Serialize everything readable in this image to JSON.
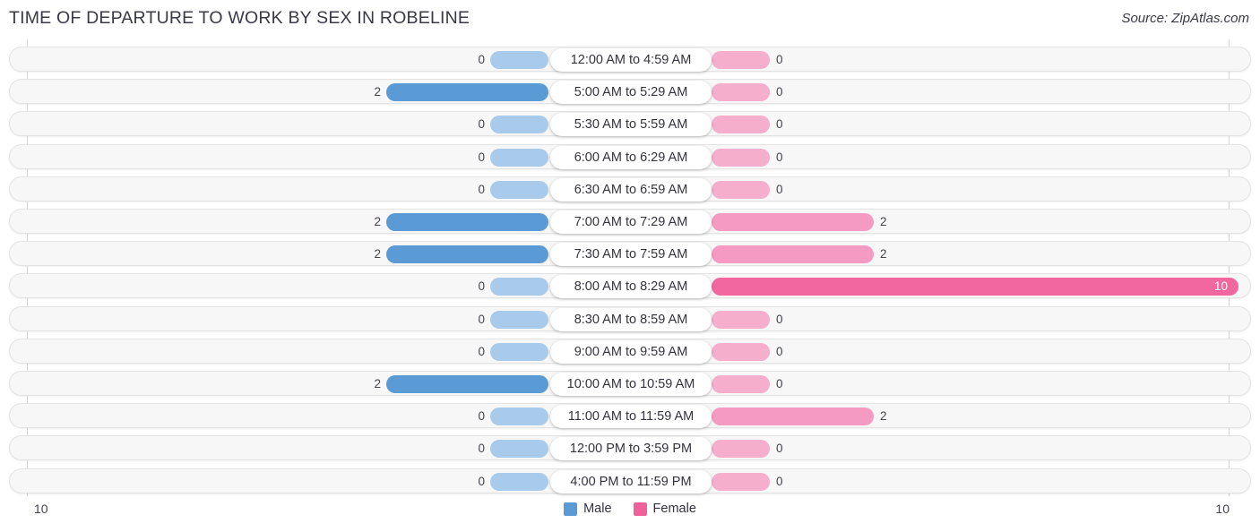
{
  "header": {
    "title": "TIME OF DEPARTURE TO WORK BY SEX IN ROBELINE",
    "source": "Source: ZipAtlas.com"
  },
  "axis": {
    "left_end_label": "10",
    "right_end_label": "10"
  },
  "legend": {
    "items": [
      {
        "label": "Male",
        "color": "#5b9bd5",
        "icon": "square-swatch-icon"
      },
      {
        "label": "Female",
        "color": "#f0619b",
        "icon": "square-swatch-icon"
      }
    ]
  },
  "colors": {
    "male_zero": "#a8cbec",
    "male_value": "#5b9bd5",
    "female_zero": "#f5aecb",
    "female_small": "#f59ac0",
    "female_large": "#f2689e",
    "track": "#f7f7f7",
    "track_border": "#e3e3e3",
    "gridline": "#d6d6d6",
    "text": "#33333d"
  },
  "chart_data": {
    "type": "bar",
    "title": "TIME OF DEPARTURE TO WORK BY SEX IN ROBELINE",
    "subtitle": "",
    "xlabel": "",
    "ylabel": "",
    "orientation": "horizontal-diverging",
    "grid": false,
    "legend_position": "bottom-center",
    "xlim": [
      10,
      10
    ],
    "axis_left_max": 10,
    "axis_right_max": 10,
    "categories": [
      "12:00 AM to 4:59 AM",
      "5:00 AM to 5:29 AM",
      "5:30 AM to 5:59 AM",
      "6:00 AM to 6:29 AM",
      "6:30 AM to 6:59 AM",
      "7:00 AM to 7:29 AM",
      "7:30 AM to 7:59 AM",
      "8:00 AM to 8:29 AM",
      "8:30 AM to 8:59 AM",
      "9:00 AM to 9:59 AM",
      "10:00 AM to 10:59 AM",
      "11:00 AM to 11:59 AM",
      "12:00 PM to 3:59 PM",
      "4:00 PM to 11:59 PM"
    ],
    "series": [
      {
        "name": "Male",
        "side": "left",
        "color": "#5b9bd5",
        "values": [
          0,
          2,
          0,
          0,
          0,
          2,
          2,
          0,
          0,
          0,
          2,
          0,
          0,
          0
        ]
      },
      {
        "name": "Female",
        "side": "right",
        "color": "#f0619b",
        "values": [
          0,
          0,
          0,
          0,
          0,
          2,
          2,
          10,
          0,
          0,
          0,
          2,
          0,
          0
        ]
      }
    ]
  },
  "rows": [
    {
      "label": "12:00 AM to 4:59 AM",
      "male": "0",
      "female": "0"
    },
    {
      "label": "5:00 AM to 5:29 AM",
      "male": "2",
      "female": "0"
    },
    {
      "label": "5:30 AM to 5:59 AM",
      "male": "0",
      "female": "0"
    },
    {
      "label": "6:00 AM to 6:29 AM",
      "male": "0",
      "female": "0"
    },
    {
      "label": "6:30 AM to 6:59 AM",
      "male": "0",
      "female": "0"
    },
    {
      "label": "7:00 AM to 7:29 AM",
      "male": "2",
      "female": "2"
    },
    {
      "label": "7:30 AM to 7:59 AM",
      "male": "2",
      "female": "2"
    },
    {
      "label": "8:00 AM to 8:29 AM",
      "male": "0",
      "female": "10"
    },
    {
      "label": "8:30 AM to 8:59 AM",
      "male": "0",
      "female": "0"
    },
    {
      "label": "9:00 AM to 9:59 AM",
      "male": "0",
      "female": "0"
    },
    {
      "label": "10:00 AM to 10:59 AM",
      "male": "2",
      "female": "0"
    },
    {
      "label": "11:00 AM to 11:59 AM",
      "male": "0",
      "female": "2"
    },
    {
      "label": "12:00 PM to 3:59 PM",
      "male": "0",
      "female": "0"
    },
    {
      "label": "4:00 PM to 11:59 PM",
      "male": "0",
      "female": "0"
    }
  ]
}
